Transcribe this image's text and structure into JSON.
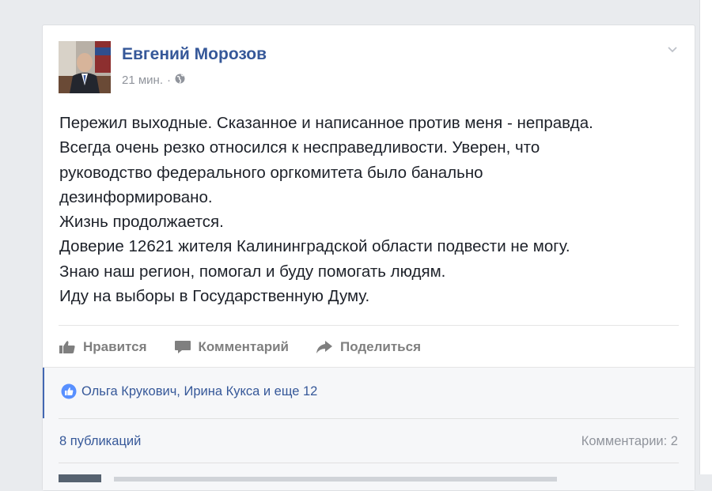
{
  "post": {
    "author": "Евгений Морозов",
    "time": "21 мин.",
    "separator": "·",
    "privacy_icon": "globe-icon",
    "menu_icon": "chevron-down-icon",
    "lines": [
      "Пережил выходные. Сказанное и написанное против меня - неправда.",
      "Всегда очень резко относился к несправедливости. Уверен, что",
      "руководство федерального оргкомитета было банально",
      "дезинформировано.",
      "Жизнь продолжается.",
      "Доверие 12621 жителя Калининградской области подвести не могу.",
      "Знаю наш регион, помогал и буду помогать людям.",
      "Иду на выборы в Государственную Думу."
    ]
  },
  "actions": {
    "like": "Нравится",
    "comment": "Комментарий",
    "share": "Поделиться"
  },
  "reactions": {
    "text": "Ольга Крукович, Ирина Кукса и еще 12"
  },
  "stats": {
    "shares": "8 публикаций",
    "comments": "Комментарии: 2"
  },
  "colors": {
    "link": "#365899",
    "accent": "#4267b2",
    "muted": "#90949c",
    "background": "#e9ebee"
  }
}
